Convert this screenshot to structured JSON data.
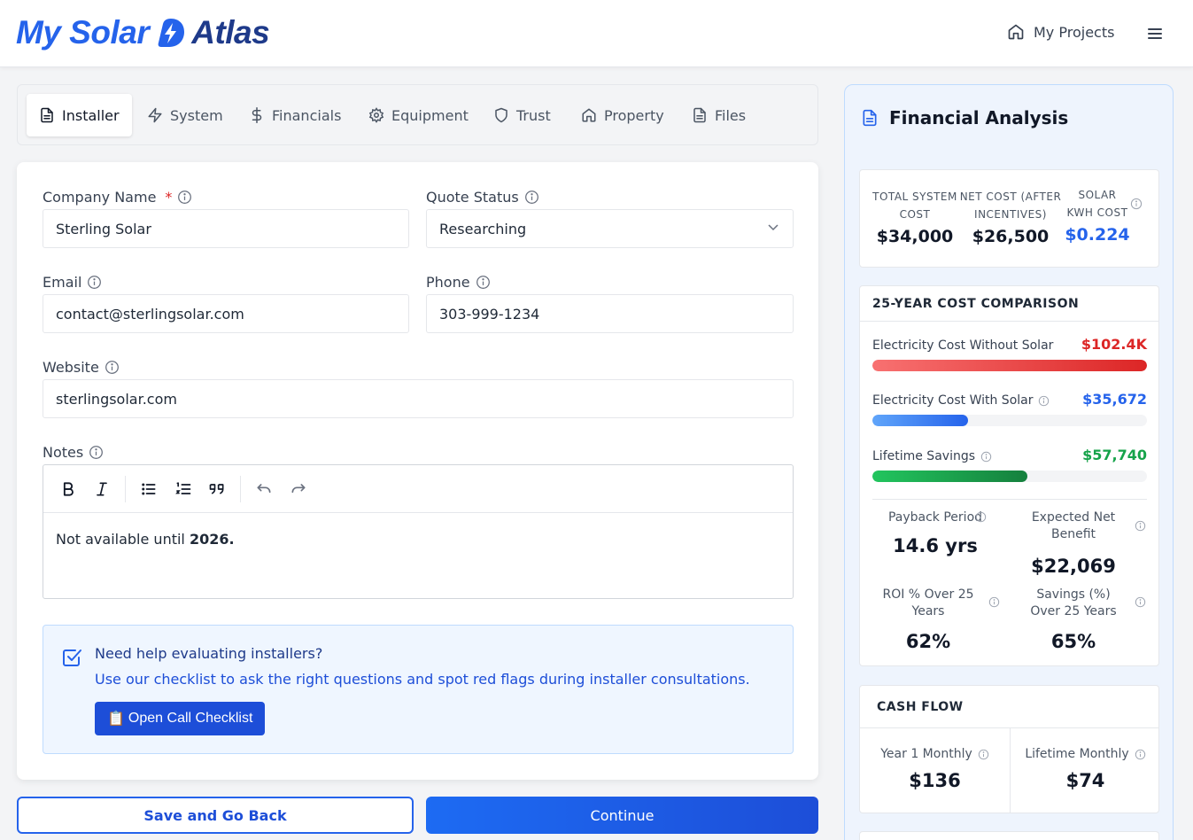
{
  "header": {
    "logo_part1": "My Solar",
    "logo_part2": "Atlas",
    "my_projects": "My Projects"
  },
  "icons": {
    "home": "home-icon",
    "menu": "menu-icon",
    "info": "info-icon",
    "chevron": "chevron-down-icon",
    "checkbox": "checkbox-icon",
    "document": "document-icon"
  },
  "tabs": [
    {
      "label": "Installer",
      "icon": "document-icon",
      "active": true
    },
    {
      "label": "System",
      "icon": "bolt-icon"
    },
    {
      "label": "Financials",
      "icon": "dollar-icon"
    },
    {
      "label": "Equipment",
      "icon": "gear-icon"
    },
    {
      "label": "Trust",
      "icon": "shield-icon"
    },
    {
      "label": "Property",
      "icon": "home-icon"
    },
    {
      "label": "Files",
      "icon": "file-icon"
    }
  ],
  "form": {
    "company_label": "Company Name",
    "required_mark": "*",
    "company_value": "Sterling Solar",
    "quote_label": "Quote Status",
    "quote_value": "Researching",
    "email_label": "Email",
    "email_value": "contact@sterlingsolar.com",
    "phone_label": "Phone",
    "phone_value": "303-999-1234",
    "website_label": "Website",
    "website_value": "sterlingsolar.com",
    "notes_label": "Notes",
    "notes_text": "Not available until ",
    "notes_bold": "2026."
  },
  "help": {
    "title": "Need help evaluating installers?",
    "subtitle": "Use our checklist to ask the right questions and spot red flags during installer consultations.",
    "button_emoji": "📋",
    "button_label": "Open Call Checklist"
  },
  "actions": {
    "back_label": "Save and Go Back",
    "continue_label": "Continue"
  },
  "analysis": {
    "title": "Financial Analysis",
    "kpis": {
      "total_label": "TOTAL SYSTEM COST",
      "total_value": "$34,000",
      "net_label": "NET COST (AFTER INCENTIVES)",
      "net_value": "$26,500",
      "kwh_label": "SOLAR KWH COST",
      "kwh_value": "$0.224"
    },
    "comparison": {
      "title": "25-YEAR COST COMPARISON",
      "without_label": "Electricity Cost Without Solar",
      "without_value": "$102.4K",
      "without_fraction": 1.0,
      "with_label": "Electricity Cost With Solar",
      "with_value": "$35,672",
      "with_fraction": 0.348,
      "savings_label": "Lifetime Savings",
      "savings_value": "$57,740",
      "savings_fraction": 0.564,
      "colors": {
        "red": "#dc2626",
        "blue": "#2563eb",
        "green": "#16a34a"
      }
    },
    "metrics": {
      "payback_label": "Payback Period",
      "payback_value": "14.6 yrs",
      "net_benefit_label": "Expected Net Benefit",
      "net_benefit_value": "$22,069",
      "roi_label": "ROI % Over 25 Years",
      "roi_value": "62%",
      "savings_pct_label": "Savings (%) Over 25 Years",
      "savings_pct_value": "65%"
    },
    "cashflow": {
      "title": "CASH FLOW",
      "year1_label": "Year 1 Monthly",
      "year1_value": "$136",
      "lifetime_label": "Lifetime Monthly",
      "lifetime_value": "$74"
    }
  }
}
